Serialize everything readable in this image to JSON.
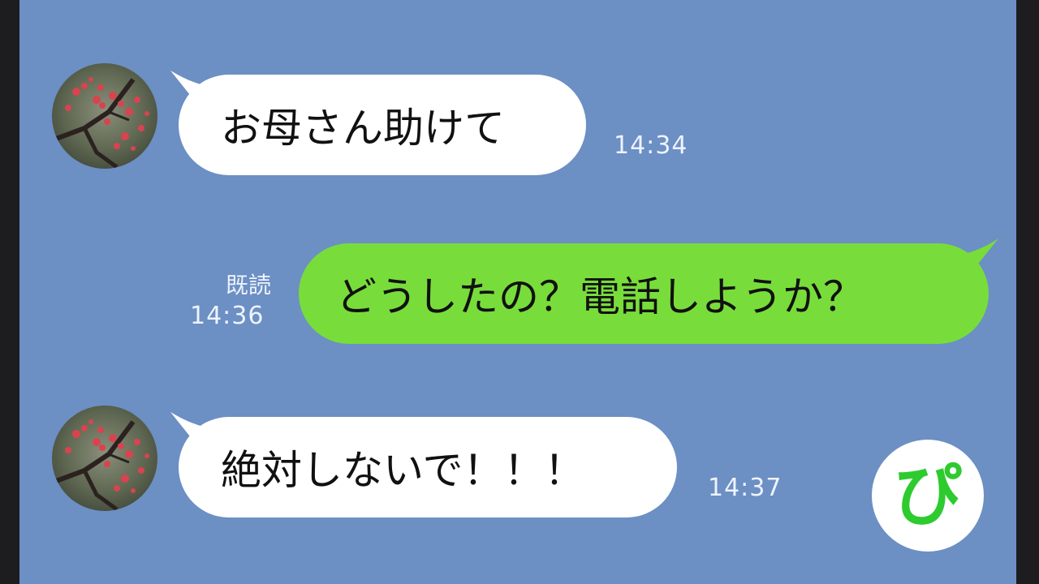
{
  "messages": [
    {
      "direction": "incoming",
      "text": "お母さん助けて",
      "time": "14:34"
    },
    {
      "direction": "outgoing",
      "text": "どうしたの？電話しようか？",
      "read_label": "既読",
      "time": "14:36"
    },
    {
      "direction": "incoming",
      "text": "絶対しないで！！！",
      "time": "14:37"
    }
  ],
  "logo": {
    "text": "ぴ"
  },
  "colors": {
    "background": "#6c8fc4",
    "incoming_bubble": "#ffffff",
    "outgoing_bubble": "#78dd3a",
    "logo_green": "#2ecb2e"
  }
}
